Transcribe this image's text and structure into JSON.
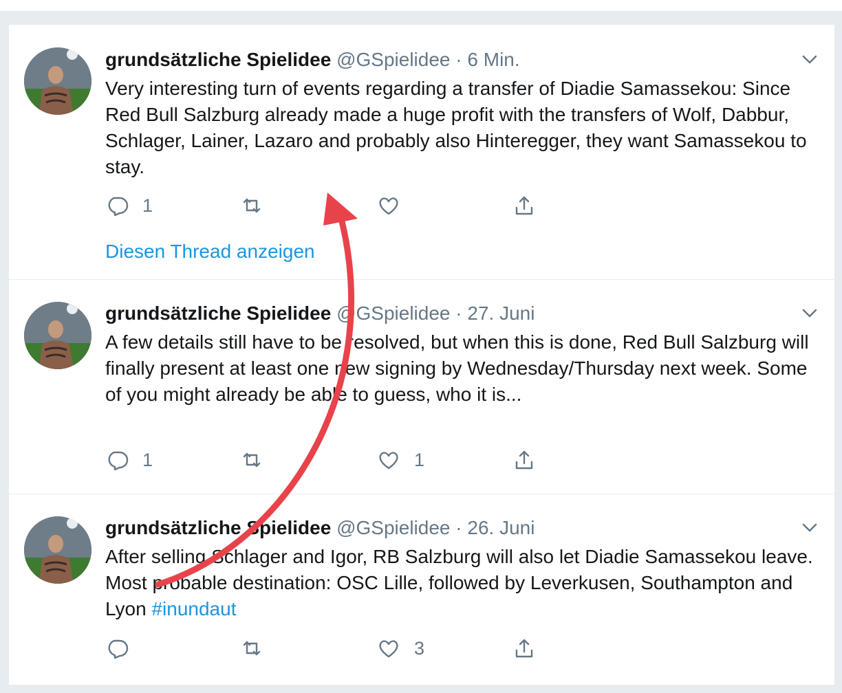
{
  "tweets": [
    {
      "name": "grundsätzliche Spielidee",
      "handle": "@GSpielidee",
      "sep": "·",
      "time": "6 Min.",
      "text": "Very interesting turn of events regarding a transfer of Diadie Samassekou: Since Red Bull Salzburg already made a huge profit with the transfers of Wolf, Dabbur, Schlager, Lainer, Lazaro and probably also Hinteregger, they want Samassekou to stay.",
      "reply_count": "1",
      "like_count": "",
      "thread_link": "Diesen Thread anzeigen"
    },
    {
      "name": "grundsätzliche Spielidee",
      "handle": "@GSpielidee",
      "sep": "·",
      "time": "27. Juni",
      "text": "A few details still have to be resolved, but when this is done, Red Bull Salzburg will finally present at least one new signing by Wednesday/Thursday next week. Some of you might already be able to guess, who it is...",
      "reply_count": "1",
      "like_count": "1"
    },
    {
      "name": "grundsätzliche Spielidee",
      "handle": "@GSpielidee",
      "sep": "·",
      "time": "26. Juni",
      "text": "After selling Schlager and Igor, RB Salzburg will also let Diadie Samassekou leave. Most probable destination: OSC Lille, followed by Leverkusen, Southampton and Lyon",
      "hashtag": "#inundaut",
      "reply_count": "",
      "like_count": "3"
    }
  ],
  "icons": {
    "reply": "reply-icon",
    "retweet": "retweet-icon",
    "like": "heart-icon",
    "share": "share-icon",
    "menu": "chevron-down-icon"
  },
  "colors": {
    "link": "#1b95e0",
    "secondary": "#657786",
    "annotation_arrow": "#e8434b"
  }
}
